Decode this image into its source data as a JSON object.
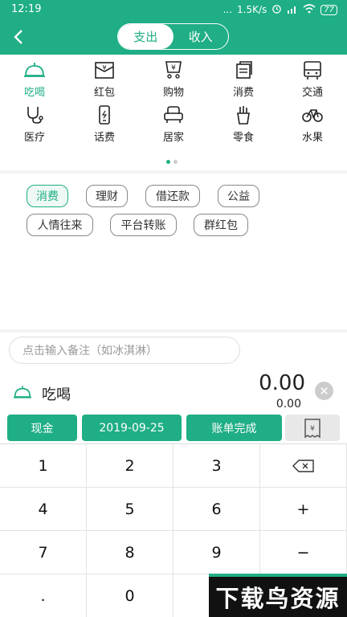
{
  "status_bar": {
    "time": "12:19",
    "indicators": "...",
    "speed": "1.5K/s",
    "battery": "77"
  },
  "header": {
    "tabs": [
      "支出",
      "收入"
    ],
    "active_tab": "支出"
  },
  "categories": [
    {
      "label": "吃喝",
      "icon": "food-cloche-icon",
      "active": true
    },
    {
      "label": "红包",
      "icon": "red-envelope-icon"
    },
    {
      "label": "购物",
      "icon": "shopping-bag-icon"
    },
    {
      "label": "消费",
      "icon": "receipt-icon"
    },
    {
      "label": "交通",
      "icon": "bus-icon"
    },
    {
      "label": "医疗",
      "icon": "stethoscope-icon"
    },
    {
      "label": "话费",
      "icon": "phone-icon"
    },
    {
      "label": "居家",
      "icon": "armchair-icon"
    },
    {
      "label": "零食",
      "icon": "fries-icon"
    },
    {
      "label": "水果",
      "icon": "bicycle-icon"
    }
  ],
  "tags": [
    {
      "label": "消费",
      "active": true
    },
    {
      "label": "理财"
    },
    {
      "label": "借还款"
    },
    {
      "label": "公益"
    },
    {
      "label": "人情往来"
    },
    {
      "label": "平台转账"
    },
    {
      "label": "群红包"
    }
  ],
  "memo": {
    "placeholder": "点击输入备注（如冰淇淋）"
  },
  "entry": {
    "category": "吃喝",
    "amount": "0.00",
    "sub_amount": "0.00"
  },
  "actions": {
    "account": "现金",
    "date": "2019-09-25",
    "done": "账单完成"
  },
  "keypad": [
    [
      "1",
      "2",
      "3",
      "⌫"
    ],
    [
      "4",
      "5",
      "6",
      "+"
    ],
    [
      "7",
      "8",
      "9",
      "−"
    ],
    [
      ".",
      "0",
      "",
      ""
    ]
  ],
  "watermark": "下载鸟资源",
  "colors": {
    "accent": "#1fae85"
  }
}
